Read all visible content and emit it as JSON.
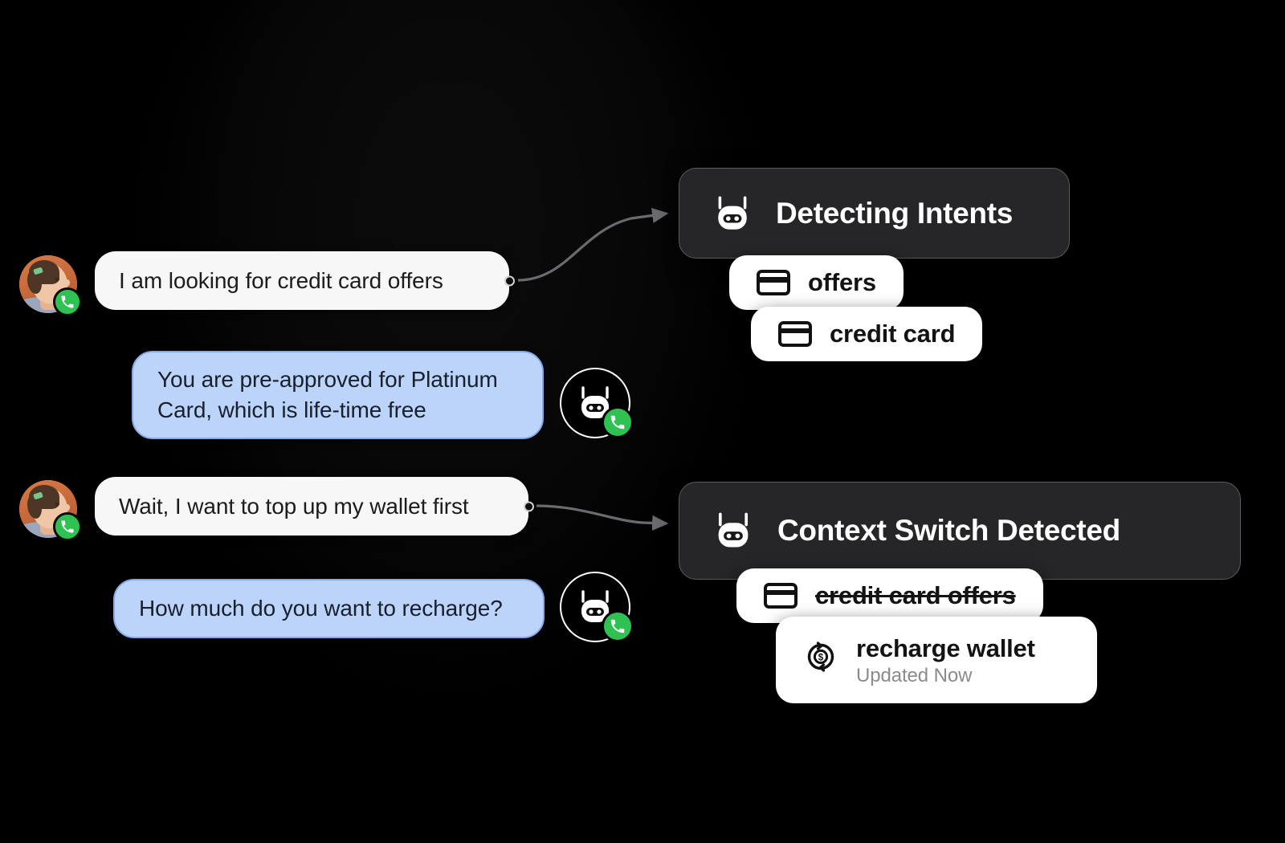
{
  "background": {
    "color": "#000000"
  },
  "conversation": {
    "messages": [
      {
        "id": "user-msg-1",
        "role": "user",
        "text": "I am looking for credit card offers",
        "avatar": "user-avatar-icon",
        "badge": "phone-call-icon"
      },
      {
        "id": "bot-msg-1",
        "role": "assistant",
        "text": "You are pre-approved for Platinum Card, which is life-time free",
        "avatar": "bot-avatar-icon",
        "badge": "phone-call-icon"
      },
      {
        "id": "user-msg-2",
        "role": "user",
        "text": "Wait, I want to top up my wallet first",
        "avatar": "user-avatar-icon",
        "badge": "phone-call-icon"
      },
      {
        "id": "bot-msg-2",
        "role": "assistant",
        "text": "How much do you want to recharge?",
        "avatar": "bot-avatar-icon",
        "badge": "phone-call-icon"
      }
    ]
  },
  "panels": [
    {
      "id": "detecting-intents",
      "title": "Detecting Intents",
      "icon": "bot-head-icon",
      "chips": [
        {
          "label": "offers",
          "icon": "credit-card-icon",
          "struck": false
        },
        {
          "label": "credit card",
          "icon": "credit-card-icon",
          "struck": false
        }
      ]
    },
    {
      "id": "context-switch-detected",
      "title": "Context Switch Detected",
      "icon": "bot-head-icon",
      "chips": [
        {
          "label": "credit card offers",
          "icon": "credit-card-icon",
          "struck": true
        },
        {
          "label": "recharge wallet",
          "icon": "recharge-wallet-icon",
          "struck": false,
          "sub": "Updated Now"
        }
      ]
    }
  ],
  "colors": {
    "user_bubble": "#f7f7f7",
    "bot_bubble": "#bcd4fa",
    "bot_bubble_border": "#86a9e8",
    "panel_bg": "#262628",
    "panel_border": "#5c5c60",
    "chip_bg": "#ffffff",
    "badge_green": "#2fc253",
    "connector": "#6b6b6f",
    "subtitle_gray": "#8b8b8e"
  }
}
